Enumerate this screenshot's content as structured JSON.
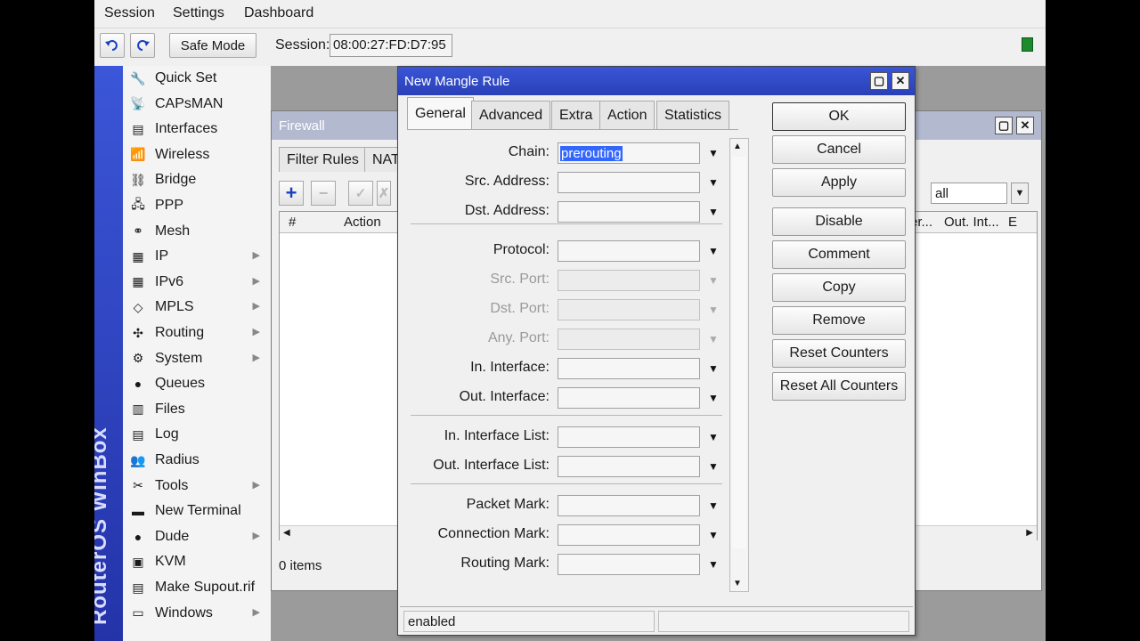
{
  "menu": [
    "Session",
    "Settings",
    "Dashboard"
  ],
  "toolbar": {
    "undo_icon": "undo-icon",
    "redo_icon": "redo-icon",
    "safe_mode": "Safe Mode",
    "session_label": "Session:",
    "session_value": "08:00:27:FD:D7:95",
    "indicator_color": "#1e8a2e"
  },
  "brand": "RouterOS WinBox",
  "sidebar": [
    {
      "label": "Quick Set",
      "icon": "quick-set-icon",
      "arrow": false
    },
    {
      "label": "CAPsMAN",
      "icon": "capsman-icon",
      "arrow": false
    },
    {
      "label": "Interfaces",
      "icon": "interfaces-icon",
      "arrow": false
    },
    {
      "label": "Wireless",
      "icon": "wireless-icon",
      "arrow": false
    },
    {
      "label": "Bridge",
      "icon": "bridge-icon",
      "arrow": false
    },
    {
      "label": "PPP",
      "icon": "ppp-icon",
      "arrow": false
    },
    {
      "label": "Mesh",
      "icon": "mesh-icon",
      "arrow": false
    },
    {
      "label": "IP",
      "icon": "ip-icon",
      "arrow": true
    },
    {
      "label": "IPv6",
      "icon": "ipv6-icon",
      "arrow": true
    },
    {
      "label": "MPLS",
      "icon": "mpls-icon",
      "arrow": true
    },
    {
      "label": "Routing",
      "icon": "routing-icon",
      "arrow": true
    },
    {
      "label": "System",
      "icon": "system-icon",
      "arrow": true
    },
    {
      "label": "Queues",
      "icon": "queues-icon",
      "arrow": false
    },
    {
      "label": "Files",
      "icon": "files-icon",
      "arrow": false
    },
    {
      "label": "Log",
      "icon": "log-icon",
      "arrow": false
    },
    {
      "label": "Radius",
      "icon": "radius-icon",
      "arrow": false
    },
    {
      "label": "Tools",
      "icon": "tools-icon",
      "arrow": true
    },
    {
      "label": "New Terminal",
      "icon": "terminal-icon",
      "arrow": false
    },
    {
      "label": "Dude",
      "icon": "dude-icon",
      "arrow": true
    },
    {
      "label": "KVM",
      "icon": "kvm-icon",
      "arrow": false
    },
    {
      "label": "Make Supout.rif",
      "icon": "supout-icon",
      "arrow": false
    },
    {
      "label": "Windows",
      "icon": "windows-icon",
      "arrow": true
    }
  ],
  "firewall": {
    "title": "Firewall",
    "tabs": [
      "Filter Rules",
      "NAT"
    ],
    "columns": [
      "#",
      "Action",
      "er...",
      "Out. Int...",
      "E"
    ],
    "filter_value": "all",
    "status": "0 items"
  },
  "dialog": {
    "title": "New Mangle Rule",
    "tabs": [
      "General",
      "Advanced",
      "Extra",
      "Action",
      "Statistics"
    ],
    "active_tab": "General",
    "fields": [
      {
        "label": "Chain:",
        "value": "prerouting",
        "disabled": false
      },
      {
        "label": "Src. Address:",
        "value": "",
        "disabled": false
      },
      {
        "label": "Dst. Address:",
        "value": "",
        "disabled": false
      },
      {
        "label": "Protocol:",
        "value": "",
        "disabled": false
      },
      {
        "label": "Src. Port:",
        "value": "",
        "disabled": true
      },
      {
        "label": "Dst. Port:",
        "value": "",
        "disabled": true
      },
      {
        "label": "Any. Port:",
        "value": "",
        "disabled": true
      },
      {
        "label": "In. Interface:",
        "value": "",
        "disabled": false
      },
      {
        "label": "Out. Interface:",
        "value": "",
        "disabled": false
      },
      {
        "label": "In. Interface List:",
        "value": "",
        "disabled": false
      },
      {
        "label": "Out. Interface List:",
        "value": "",
        "disabled": false
      },
      {
        "label": "Packet Mark:",
        "value": "",
        "disabled": false
      },
      {
        "label": "Connection Mark:",
        "value": "",
        "disabled": false
      },
      {
        "label": "Routing Mark:",
        "value": "",
        "disabled": false
      }
    ],
    "buttons": [
      "OK",
      "Cancel",
      "Apply",
      "Disable",
      "Comment",
      "Copy",
      "Remove",
      "Reset Counters",
      "Reset All Counters"
    ],
    "status": "enabled"
  }
}
